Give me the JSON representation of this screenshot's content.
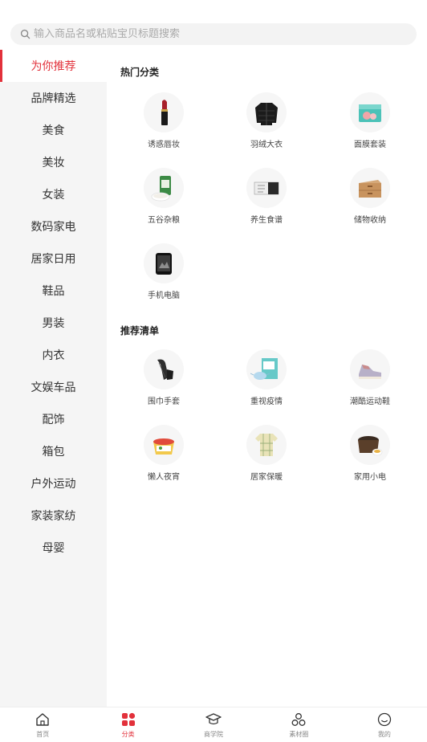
{
  "search": {
    "placeholder": "输入商品名或粘贴宝贝标题搜索"
  },
  "sidebar": {
    "items": [
      {
        "label": "为你推荐",
        "active": true
      },
      {
        "label": "品牌精选"
      },
      {
        "label": "美食"
      },
      {
        "label": "美妆"
      },
      {
        "label": "女装"
      },
      {
        "label": "数码家电"
      },
      {
        "label": "居家日用"
      },
      {
        "label": "鞋品"
      },
      {
        "label": "男装"
      },
      {
        "label": "内衣"
      },
      {
        "label": "文娱车品"
      },
      {
        "label": "配饰"
      },
      {
        "label": "箱包"
      },
      {
        "label": "户外运动"
      },
      {
        "label": "家装家纺"
      },
      {
        "label": "母婴"
      }
    ]
  },
  "hot": {
    "title": "热门分类",
    "items": [
      {
        "label": "诱惑唇妆",
        "icon": "lipstick-icon"
      },
      {
        "label": "羽绒大衣",
        "icon": "down-jacket-icon"
      },
      {
        "label": "面膜套装",
        "icon": "face-mask-box-icon"
      },
      {
        "label": "五谷杂粮",
        "icon": "rice-bag-icon"
      },
      {
        "label": "养生食谱",
        "icon": "health-book-icon"
      },
      {
        "label": "储物收纳",
        "icon": "storage-drawer-icon"
      },
      {
        "label": "手机电脑",
        "icon": "phone-icon"
      }
    ]
  },
  "recommend": {
    "title": "推荐清单",
    "items": [
      {
        "label": "围巾手套",
        "icon": "scarf-gloves-icon"
      },
      {
        "label": "重视疫情",
        "icon": "face-mask-pack-icon"
      },
      {
        "label": "潮酷运动鞋",
        "icon": "sneaker-icon"
      },
      {
        "label": "懒人夜宵",
        "icon": "instant-noodles-icon"
      },
      {
        "label": "居家保暖",
        "icon": "pajamas-icon"
      },
      {
        "label": "家用小电",
        "icon": "rice-cooker-icon"
      }
    ]
  },
  "tabbar": {
    "items": [
      {
        "label": "首页",
        "icon": "home-icon"
      },
      {
        "label": "分类",
        "icon": "category-icon",
        "active": true
      },
      {
        "label": "商学院",
        "icon": "graduation-cap-icon"
      },
      {
        "label": "素材圈",
        "icon": "material-circle-icon"
      },
      {
        "label": "我的",
        "icon": "profile-icon"
      }
    ]
  },
  "colors": {
    "accent": "#e2313b",
    "sidebar_bg": "#f5f5f5"
  }
}
